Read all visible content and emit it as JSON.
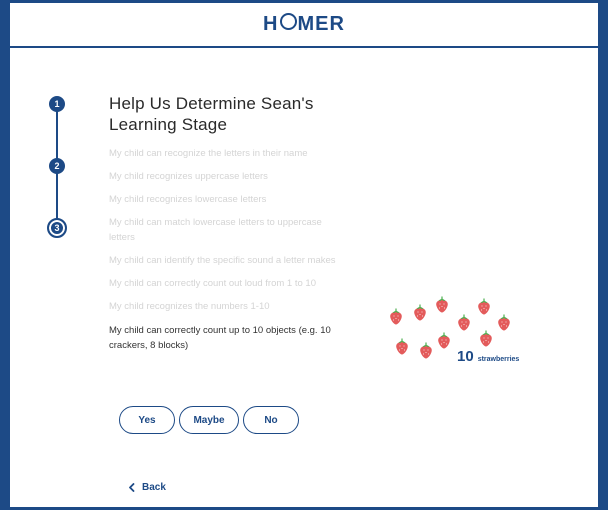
{
  "header": {
    "logo_text": "HOMER"
  },
  "stepper": {
    "steps": [
      "1",
      "2",
      "3"
    ],
    "active_step": 3
  },
  "main": {
    "title": "Help Us Determine Sean's Learning Stage",
    "completed_statements": [
      "My child can recognize the letters in their name",
      "My child recognizes uppercase letters",
      "My child recognizes lowercase letters",
      "My child can match lowercase letters to uppercase letters",
      "My child can identify the specific sound a letter makes",
      "My child can correctly count out loud from 1 to 10",
      "My child recognizes the numbers 1-10"
    ],
    "current_statement": "My child can correctly count up to 10 objects (e.g. 10 crackers, 8 blocks)"
  },
  "answers": {
    "yes": "Yes",
    "maybe": "Maybe",
    "no": "No"
  },
  "navigation": {
    "back_label": "Back"
  },
  "illustration": {
    "count": "10",
    "label": "strawberries",
    "icon": "strawberry-icon"
  },
  "colors": {
    "brand": "#1d4a86",
    "strawberry": "#e35b5b",
    "leaf": "#4caf50",
    "muted_text": "#d4d4d4"
  }
}
